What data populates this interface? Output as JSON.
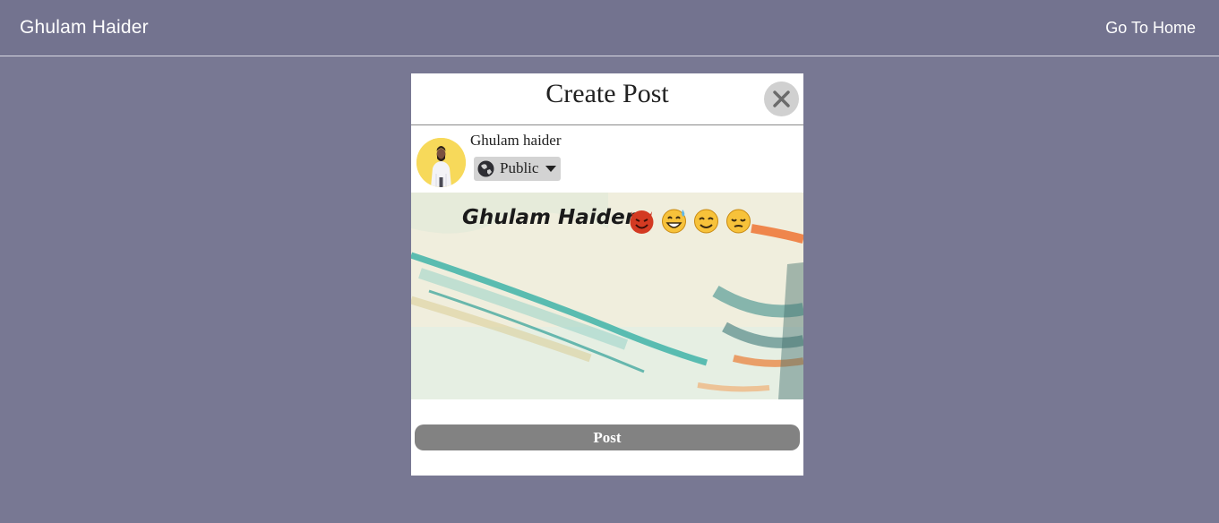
{
  "navbar": {
    "brand": "Ghulam Haider",
    "home_link": "Go To Home"
  },
  "modal": {
    "title": "Create Post",
    "close_icon": "close-icon",
    "user": {
      "name": "Ghulam haider",
      "avatar_icon": "user-avatar"
    },
    "privacy": {
      "label": "Public",
      "icon": "globe-icon",
      "dropdown_icon": "caret-down-icon"
    },
    "post_image": {
      "overlay_text": "Ghulam Haider",
      "emojis": [
        "smiling-devil-emoji",
        "grinning-sweat-emoji",
        "smiling-eyes-emoji",
        "pensive-emoji"
      ]
    },
    "post_button": "Post"
  },
  "colors": {
    "page_background": "#787893",
    "navbar_background": "#73738f",
    "modal_background": "#ffffff",
    "close_button": "#d0d0d0",
    "privacy_button": "#d3d3d3",
    "post_button": "#828282",
    "avatar_background": "#f7d95a"
  }
}
